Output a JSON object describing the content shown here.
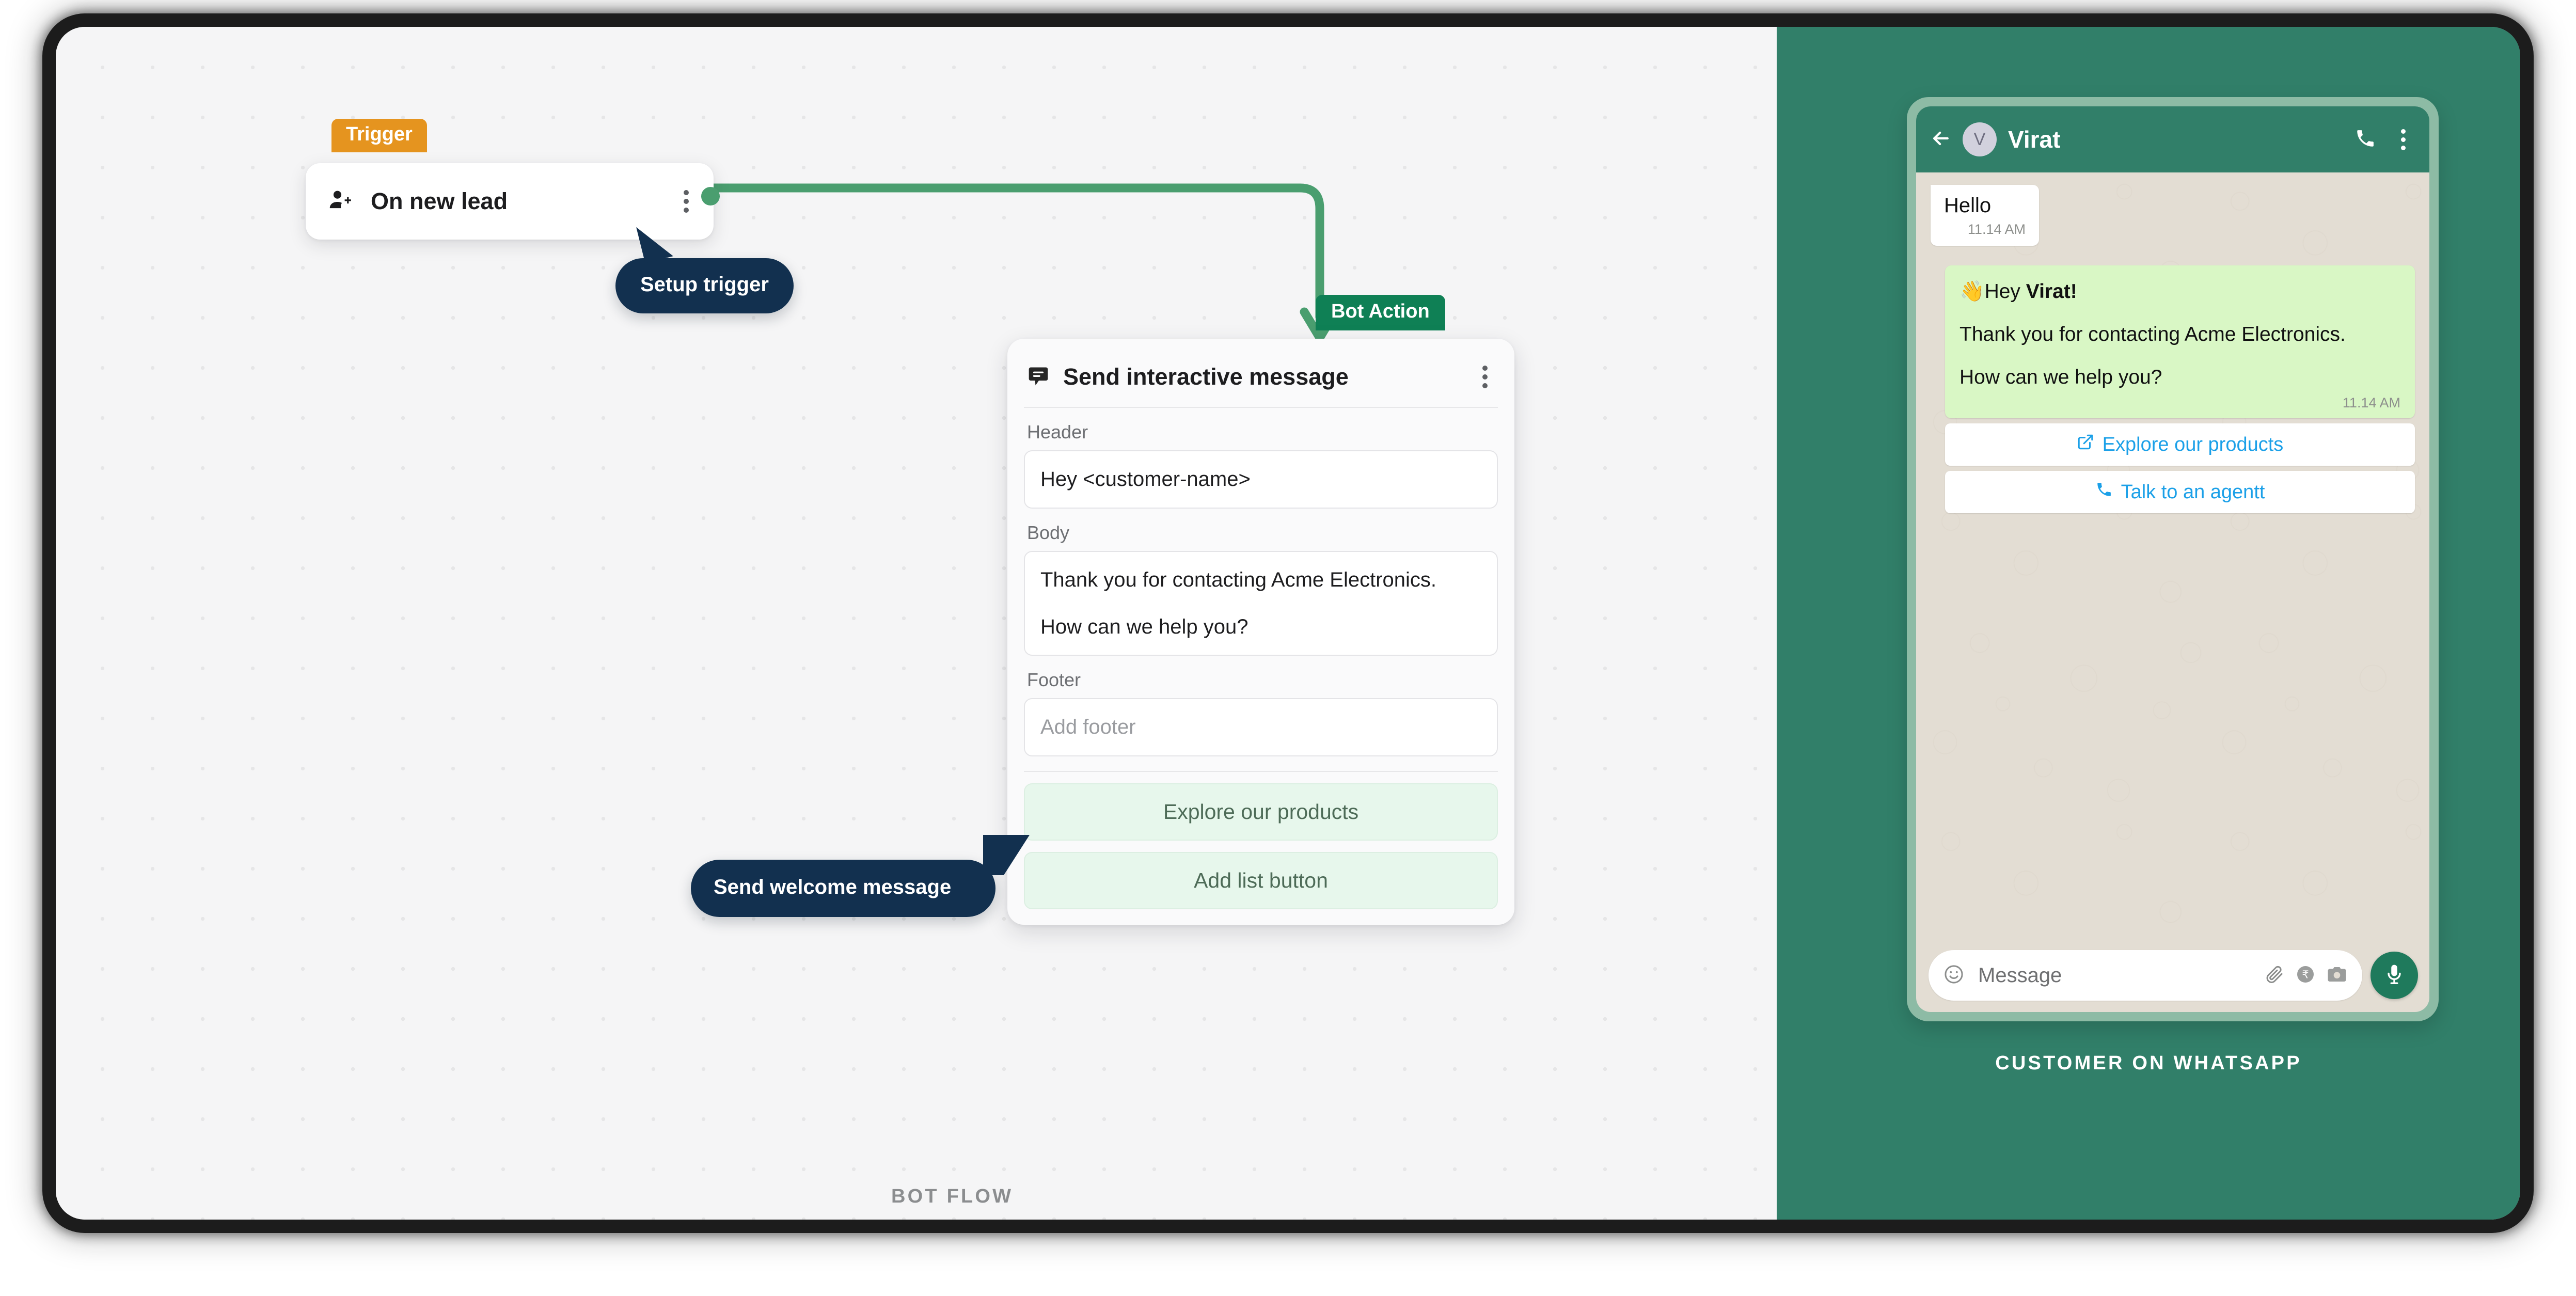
{
  "flow": {
    "caption": "BOT FLOW",
    "trigger": {
      "badge": "Trigger",
      "title": "On new lead",
      "tooltip": "Setup trigger"
    },
    "bot_action": {
      "badge": "Bot Action",
      "title": "Send interactive message",
      "tooltip": "Send welcome message",
      "fields": [
        {
          "label": "Header",
          "value": "Hey <customer-name>",
          "placeholder": false
        },
        {
          "label": "Body",
          "value_lines": [
            "Thank you for contacting Acme Electronics.",
            "How can we help you?"
          ],
          "placeholder": false
        },
        {
          "label": "Footer",
          "value": "Add footer",
          "placeholder": true
        }
      ],
      "buttons": [
        "Explore our products",
        "Add list button"
      ]
    }
  },
  "whatsapp": {
    "caption": "CUSTOMER ON WHATSAPP",
    "header": {
      "contact_name": "Virat",
      "avatar_initial": "V",
      "back_icon": "back-arrow-icon",
      "call_icon": "phone-icon",
      "menu_icon": "kebab-menu-icon"
    },
    "messages": [
      {
        "direction": "incoming",
        "text": "Hello",
        "time": "11.14 AM"
      },
      {
        "direction": "outgoing",
        "greeting_emoji": "👋",
        "greeting_prefix": "Hey ",
        "greeting_name": "Virat!",
        "lines": [
          "Thank you for contacting Acme Electronics.",
          "How can we help you?"
        ],
        "time": "11.14 AM"
      }
    ],
    "cta_buttons": [
      {
        "label": "Explore our products",
        "icon": "external-link-icon"
      },
      {
        "label": "Talk to an agentt",
        "icon": "phone-icon"
      }
    ],
    "input_bar": {
      "placeholder": "Message",
      "emoji_icon": "smiley-icon",
      "attach_icon": "paperclip-icon",
      "payment_icon": "rupee-coin-icon",
      "camera_icon": "camera-icon",
      "mic_icon": "microphone-icon"
    }
  },
  "colors": {
    "trigger_orange": "#e5941f",
    "bot_green": "#0f8055",
    "whatsapp_panel": "#317f69",
    "tooltip_navy": "#12304f",
    "connector_green": "#4a9e6f",
    "cta_blue": "#1ba0e8",
    "bubble_green": "#d9f7c5"
  }
}
